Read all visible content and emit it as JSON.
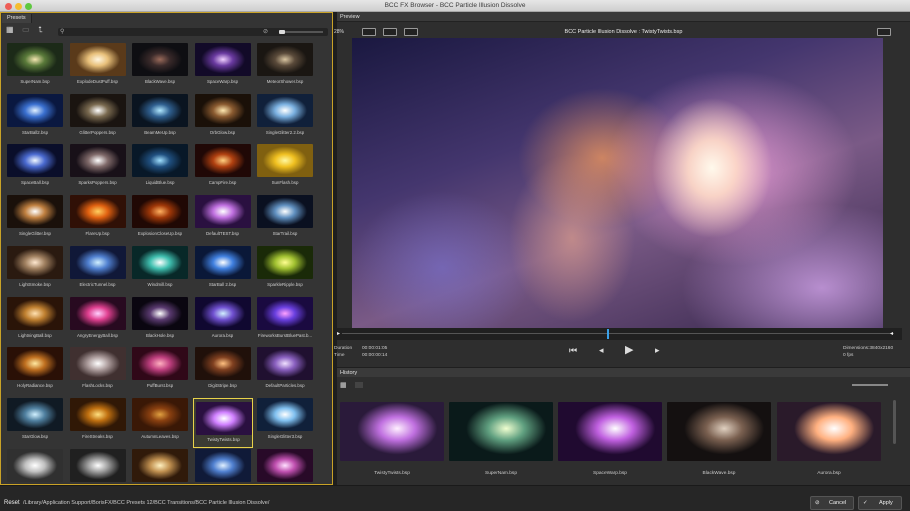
{
  "window": {
    "title": "BCC FX Browser - BCC Particle Illusion Dissolve"
  },
  "presets_panel": {
    "tab_label": "Presets"
  },
  "presets": [
    "SuperNam.bsp",
    "ExplodeDustPuff.bsp",
    "BlackWave.bsp",
    "SpaceWarp.bsp",
    "MeteorShower.bsp",
    "StarBall2.bsp",
    "GlitterPoppers.bsp",
    "BeamMeUp.bsp",
    "OrbGlow.bsp",
    "SingleGlitter2.2.bsp",
    "SpaceBall.bsp",
    "SparksPoppers.bsp",
    "LiquidBlue.bsp",
    "CampFire.bsp",
    "SunFlash.bsp",
    "SingleGlitter.bsp",
    "FlareUp.bsp",
    "ExplosionCloseUp.bsp",
    "DefaultTEST.bsp",
    "StarTrail.bsp",
    "LightSmoke.bsp",
    "ElectricTunnel.bsp",
    "Windmill.bsp",
    "StarBall 2.bsp",
    "SparkleRipple.bsp",
    "LightningBall.bsp",
    "AngryEnergyBall.bsp",
    "BlackHole.bsp",
    "Aurora.bsp",
    "FireworksBurstBluePast.b...",
    "HolyRadiance.bsp",
    "FlashLocks.bsp",
    "PuffBurst.bsp",
    "DigitStripe.bsp",
    "DefaultParticles.bsp",
    "StarGlow.bsp",
    "FireStreaks.bsp",
    "AutumnLeaves.bsp",
    "TwistyTwists.bsp",
    "SingleGlitter3.bsp",
    "",
    "",
    "",
    "",
    ""
  ],
  "selected_preset": "TwistyTwists.bsp",
  "preview": {
    "tab_label": "Preview",
    "zoom": "28%",
    "title": "BCC Particle Illusion Dissolve : TwistyTwists.bsp",
    "duration_label": "Duration",
    "duration_value": "00:00:01:05",
    "time_label": "Time",
    "time_value": "00:00:00:14",
    "dimensions": "Dimensions:3840x2160",
    "fps": "0 fps",
    "playhead_fraction": 0.48
  },
  "history": {
    "tab_label": "History",
    "items": [
      "TwistyTwists.bsp",
      "SuperNam.bsp",
      "SpaceWarp.bsp",
      "BlackWave.bsp",
      "Aurora.bsp"
    ]
  },
  "footer": {
    "reset_label": "Reset",
    "path": "/Library/Application Support/BorisFX/BCC Presets 12/BCC Transitions/BCC Particle Illusion Dissolve/",
    "cancel_label": "Cancel",
    "apply_label": "Apply"
  },
  "icons": {
    "grid": "grid-view-icon",
    "up": "folder-up-icon",
    "search": "search-icon",
    "clear": "clear-search-icon",
    "rewind": "go-to-start-icon",
    "step_back": "step-back-icon",
    "play": "play-icon",
    "step_forward": "step-forward-icon"
  },
  "colors": {
    "selection": "#e8d24a",
    "playhead": "#3aa0e8",
    "accent": "#c9a227"
  }
}
